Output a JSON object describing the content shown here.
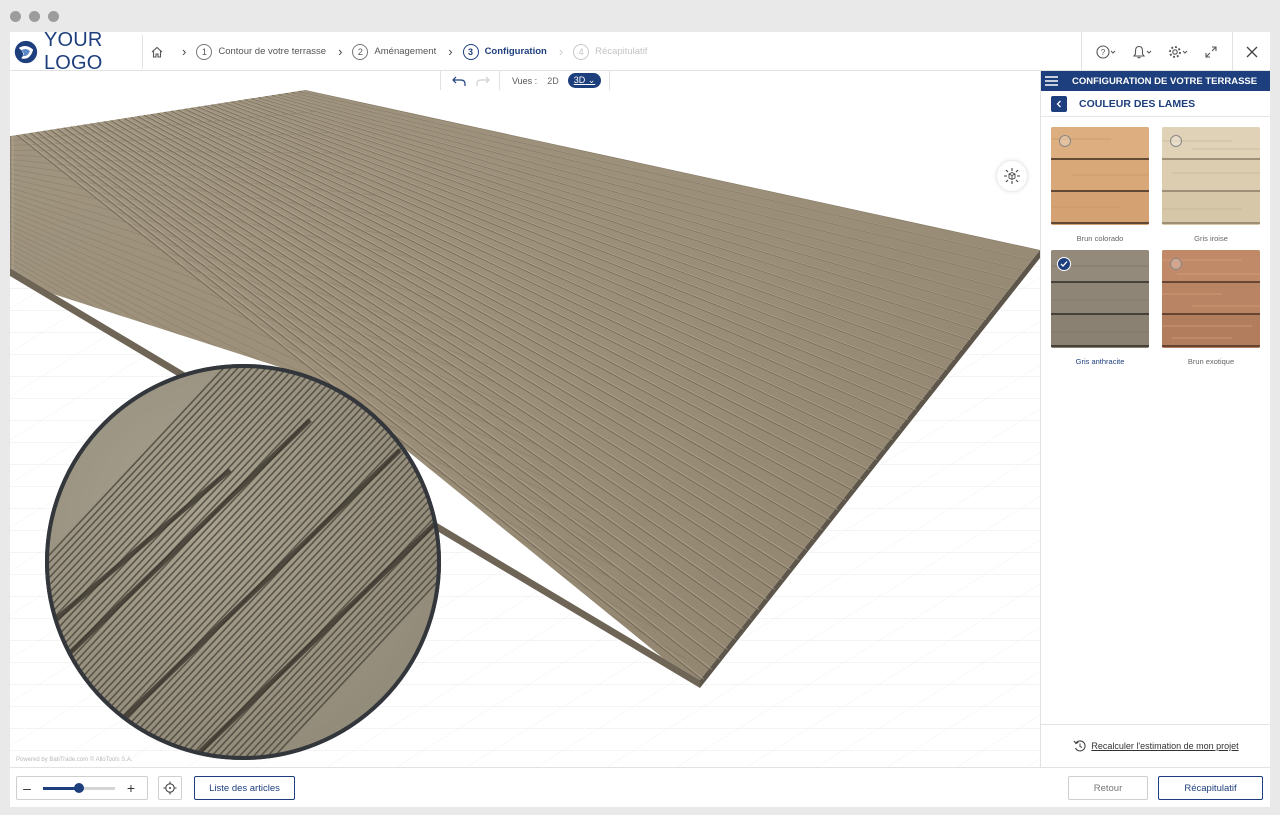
{
  "header": {
    "logo_text": "YOUR LOGO",
    "steps": [
      {
        "num": "1",
        "label": "Contour de votre terrasse",
        "state": "done"
      },
      {
        "num": "2",
        "label": "Aménagement",
        "state": "done"
      },
      {
        "num": "3",
        "label": "Configuration",
        "state": "active"
      },
      {
        "num": "4",
        "label": "Récapitulatif",
        "state": "disabled"
      }
    ],
    "icons": [
      "home-icon",
      "help-icon",
      "bell-icon",
      "gear-icon",
      "expand-icon",
      "close-icon"
    ]
  },
  "toolbar": {
    "views_label": "Vues :",
    "view_2d": "2D",
    "view_3d": "3D",
    "active_view": "3D"
  },
  "viewport": {
    "credit": "Powered by BatiTrade.com © AlloTools S.A."
  },
  "panel": {
    "title": "CONFIGURATION DE VOTRE TERRASSE",
    "subtitle": "COULEUR DES LAMES",
    "swatches": [
      {
        "label": "Brun colorado",
        "color": "#d9a878",
        "selected": false
      },
      {
        "label": "Gris iroise",
        "color": "#dccdb0",
        "selected": false
      },
      {
        "label": "Gris anthracite",
        "color": "#8e8577",
        "selected": true
      },
      {
        "label": "Brun exotique",
        "color": "#b98463",
        "selected": false
      }
    ],
    "recalc_label": "Recalculer l'estimation de mon projet"
  },
  "footer": {
    "zoom_level": 0.5,
    "zoom_minus": "–",
    "zoom_plus": "+",
    "list_button": "Liste des articles",
    "back_button": "Retour",
    "summary_button": "Récapitulatif"
  },
  "colors": {
    "brand": "#1e3f7d",
    "deck": "#9a8e79"
  }
}
